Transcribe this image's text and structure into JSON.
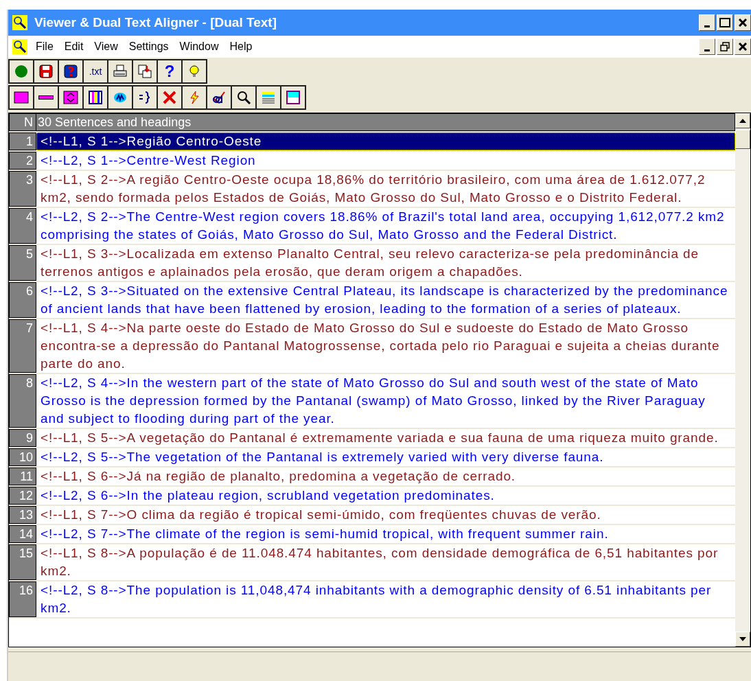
{
  "window": {
    "title": "Viewer & Dual Text Aligner - [Dual Text]"
  },
  "menu": [
    "File",
    "Edit",
    "View",
    "Settings",
    "Window",
    "Help"
  ],
  "toolbars": [
    [
      {
        "kind": "icon"
      },
      {
        "kind": "icon"
      },
      {
        "kind": "icon"
      },
      {
        "kind": "text",
        "label": ".txt"
      },
      {
        "kind": "icon"
      },
      {
        "kind": "icon"
      },
      {
        "kind": "text",
        "label": "?"
      },
      {
        "kind": "icon"
      }
    ],
    [
      {
        "kind": "icon"
      },
      {
        "kind": "icon"
      },
      {
        "kind": "icon"
      },
      {
        "kind": "icon"
      },
      {
        "kind": "icon"
      },
      {
        "kind": "icon"
      },
      {
        "kind": "icon"
      },
      {
        "kind": "icon"
      },
      {
        "kind": "icon"
      },
      {
        "kind": "icon"
      },
      {
        "kind": "icon"
      },
      {
        "kind": "icon"
      }
    ]
  ],
  "grid": {
    "number_header": "N",
    "text_header": "30 Sentences and headings",
    "rows": [
      {
        "n": "1",
        "kind": "source",
        "selected": true,
        "text": "<!--L1, S 1-->Região Centro-Oeste"
      },
      {
        "n": "2",
        "kind": "target",
        "selected": false,
        "text": "<!--L2, S 1-->Centre-West Region"
      },
      {
        "n": "3",
        "kind": "source",
        "selected": false,
        "text": "<!--L1, S 2-->A região Centro-Oeste ocupa 18,86% do território brasileiro, com uma área de 1.612.077,2 km2, sendo formada pelos Estados de Goiás, Mato Grosso do Sul, Mato Grosso e o Distrito Federal."
      },
      {
        "n": "4",
        "kind": "target",
        "selected": false,
        "text": "<!--L2, S 2-->The Centre-West region covers 18.86% of Brazil's total land area, occupying 1,612,077.2 km2 comprising the states of Goiás, Mato Grosso do Sul, Mato Grosso and the Federal District."
      },
      {
        "n": "5",
        "kind": "source",
        "selected": false,
        "text": "<!--L1, S 3-->Localizada em extenso Planalto Central, seu relevo caracteriza-se pela predominância de terrenos antigos e aplainados pela erosão, que deram origem a chapadões."
      },
      {
        "n": "6",
        "kind": "target",
        "selected": false,
        "text": "<!--L2, S 3-->Situated on the extensive Central Plateau, its landscape is characterized by the predominance of ancient lands that have been flattened by erosion, leading to the formation of a series of plateaux."
      },
      {
        "n": "7",
        "kind": "source",
        "selected": false,
        "text": "<!--L1, S 4-->Na parte oeste do Estado de Mato Grosso do Sul e sudoeste do Estado de Mato Grosso encontra-se a depressão do Pantanal Matogrossense, cortada pelo rio Paraguai e sujeita a cheias durante parte do ano."
      },
      {
        "n": "8",
        "kind": "target",
        "selected": false,
        "text": "<!--L2, S 4-->In the western part of the state of Mato Grosso do Sul and south west of the state of Mato Grosso is the depression formed by the Pantanal (swamp) of Mato Grosso, linked by the River Paraguay and subject to flooding during part of the year."
      },
      {
        "n": "9",
        "kind": "source",
        "selected": false,
        "text": "<!--L1, S 5-->A vegetação do Pantanal é extremamente variada e sua fauna de uma riqueza muito grande."
      },
      {
        "n": "10",
        "kind": "target",
        "selected": false,
        "text": "<!--L2, S 5-->The vegetation of the Pantanal is extremely varied with very diverse fauna."
      },
      {
        "n": "11",
        "kind": "source",
        "selected": false,
        "text": "<!--L1, S 6-->Já na região de planalto, predomina a vegetação de cerrado."
      },
      {
        "n": "12",
        "kind": "target",
        "selected": false,
        "text": "<!--L2, S 6-->In the plateau region, scrubland vegetation predominates."
      },
      {
        "n": "13",
        "kind": "source",
        "selected": false,
        "text": "<!--L1, S 7-->O clima da região é tropical semi-úmido, com freqüentes chuvas de verão."
      },
      {
        "n": "14",
        "kind": "target",
        "selected": false,
        "text": "<!--L2, S 7-->The climate of the region is semi-humid tropical, with frequent summer rain."
      },
      {
        "n": "15",
        "kind": "source",
        "selected": false,
        "text": "<!--L1, S 8-->A população é de 11.048.474 habitantes, com densidade demográfica de 6,51 habitantes por km2."
      },
      {
        "n": "16",
        "kind": "target",
        "selected": false,
        "text": "<!--L2, S 8-->The population is 11,048,474 inhabitants with a demographic density of 6.51 inhabitants per km2."
      }
    ]
  }
}
